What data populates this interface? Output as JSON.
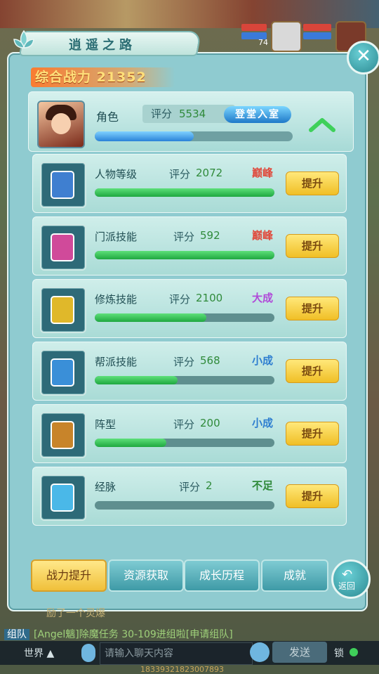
{
  "window": {
    "title": "逍遥之路"
  },
  "power": {
    "text": "综合战力 21352"
  },
  "role": {
    "name": "角色",
    "score_label": "评分",
    "score": "5534",
    "badge": "登堂入室",
    "progress": 0.5
  },
  "rows": [
    {
      "name": "人物等级",
      "score_label": "评分",
      "score": "2072",
      "rank": "巅峰",
      "rank_color": "#e0483a",
      "progress": 1.0,
      "button": "提升",
      "icon": "book-person-icon"
    },
    {
      "name": "门派技能",
      "score_label": "评分",
      "score": "592",
      "rank": "巅峰",
      "rank_color": "#e0483a",
      "progress": 1.0,
      "button": "提升",
      "icon": "pink-spellbook-icon"
    },
    {
      "name": "修炼技能",
      "score_label": "评分",
      "score": "2100",
      "rank": "大成",
      "rank_color": "#b04ad8",
      "progress": 0.62,
      "button": "提升",
      "icon": "golden-orb-icon"
    },
    {
      "name": "帮派技能",
      "score_label": "评分",
      "score": "568",
      "rank": "小成",
      "rank_color": "#2e7ed0",
      "progress": 0.46,
      "button": "提升",
      "icon": "guild-book-icon"
    },
    {
      "name": "阵型",
      "score_label": "评分",
      "score": "200",
      "rank": "小成",
      "rank_color": "#2e7ed0",
      "progress": 0.4,
      "button": "提升",
      "icon": "taiji-book-icon"
    },
    {
      "name": "经脉",
      "score_label": "评分",
      "score": "2",
      "rank": "不足",
      "rank_color": "#2f8a3a",
      "progress": 0.0,
      "button": "提升",
      "icon": "blue-crystal-icon"
    }
  ],
  "tabs": [
    {
      "label": "战力提升",
      "active": true
    },
    {
      "label": "资源获取",
      "active": false
    },
    {
      "label": "成长历程",
      "active": false
    },
    {
      "label": "成就",
      "active": false
    }
  ],
  "back": {
    "label": "返回"
  },
  "chat": {
    "system_msg": "励了一个灵爆",
    "team_tag": "组队",
    "line": "[Angel魑]除魔任务 30-109进组啦[申请组队]",
    "channel": "世界",
    "input_placeholder": "请输入聊天内容",
    "send": "发送",
    "lock": "锁"
  },
  "footer": "18339321823007893",
  "hud": {
    "level": "74"
  }
}
